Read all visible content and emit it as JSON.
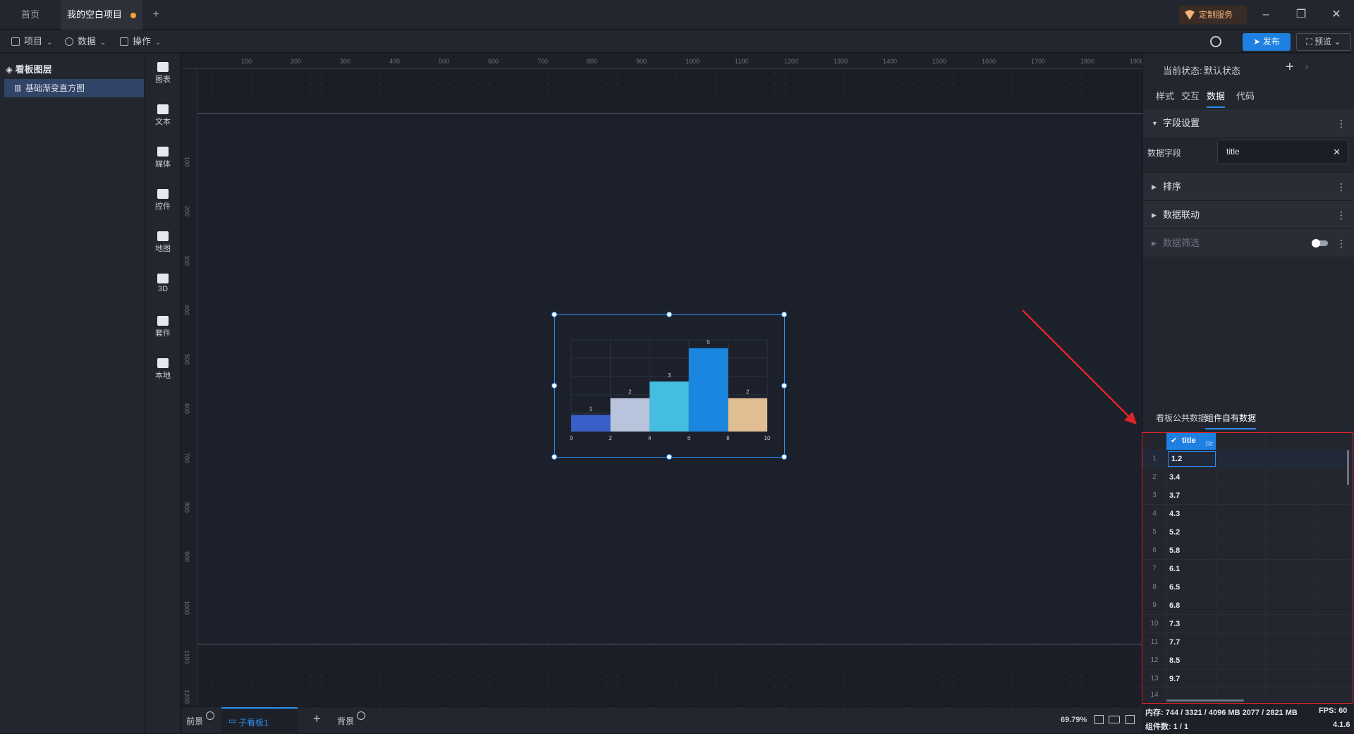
{
  "tabs": {
    "home": "首页",
    "project": "我的空白项目",
    "add": "+"
  },
  "window": {
    "custom_service": "定制服务",
    "minimize": "–",
    "restore": "❐",
    "close": "✕"
  },
  "menu": {
    "project": "项目",
    "data": "数据",
    "operation": "操作",
    "publish": "发布",
    "preview": "预览"
  },
  "layers": {
    "header": "看板图层",
    "item": "基础渐变直方图"
  },
  "tools": [
    "图表",
    "文本",
    "媒体",
    "控件",
    "地图",
    "3D",
    "套件",
    "本地"
  ],
  "ruler": {
    "top": [
      "100",
      "200",
      "300",
      "400",
      "500",
      "600",
      "700",
      "800",
      "900",
      "1000",
      "1100",
      "1200",
      "1300",
      "1400",
      "1500",
      "1600",
      "1700",
      "1800",
      "1900"
    ],
    "left": [
      "100",
      "200",
      "300",
      "400",
      "500",
      "600",
      "700",
      "800",
      "900",
      "1000",
      "1100",
      "1200"
    ]
  },
  "chart_data": {
    "type": "bar",
    "x": [
      0,
      2,
      4,
      6,
      8,
      10
    ],
    "bins": [
      [
        0,
        2
      ],
      [
        2,
        4
      ],
      [
        4,
        6
      ],
      [
        6,
        8
      ],
      [
        8,
        10
      ]
    ],
    "values": [
      1,
      2,
      3,
      5,
      2
    ],
    "colors": [
      "#3a5fc8",
      "#b8c4dc",
      "#45bde0",
      "#1a86e0",
      "#e0be92"
    ],
    "ylim": [
      0,
      5.5
    ],
    "grid": true
  },
  "bottom": {
    "foreground": "前景",
    "subboard": "子看板1",
    "add": "+",
    "background": "背景",
    "zoom": "69.79%"
  },
  "right": {
    "state_label": "当前状态:",
    "state_value": "默认状态",
    "tabs": [
      "样式",
      "交互",
      "数据",
      "代码"
    ],
    "sections": {
      "field_settings": "字段设置",
      "sort": "排序",
      "linkage": "数据联动",
      "filter": "数据筛选"
    },
    "data_field_label": "数据字段",
    "data_field_value": "title",
    "source_tabs": [
      "看板公共数据",
      "组件自有数据"
    ],
    "column_header": "title",
    "column_type": "Str",
    "rows": [
      {
        "n": "1",
        "v": "1.2"
      },
      {
        "n": "2",
        "v": "3.4"
      },
      {
        "n": "3",
        "v": "3.7"
      },
      {
        "n": "4",
        "v": "4.3"
      },
      {
        "n": "5",
        "v": "5.2"
      },
      {
        "n": "6",
        "v": "5.8"
      },
      {
        "n": "7",
        "v": "6.1"
      },
      {
        "n": "8",
        "v": "6.5"
      },
      {
        "n": "9",
        "v": "6.8"
      },
      {
        "n": "10",
        "v": "7.3"
      },
      {
        "n": "11",
        "v": "7.7"
      },
      {
        "n": "12",
        "v": "8.5"
      },
      {
        "n": "13",
        "v": "9.7"
      },
      {
        "n": "14",
        "v": ""
      }
    ]
  },
  "status": {
    "memory": "内存: 744 / 3321 / 4096 MB 2077 / 2821 MB",
    "fps": "FPS: 60",
    "components": "组件数: 1 / 1",
    "version": "4.1.6"
  }
}
